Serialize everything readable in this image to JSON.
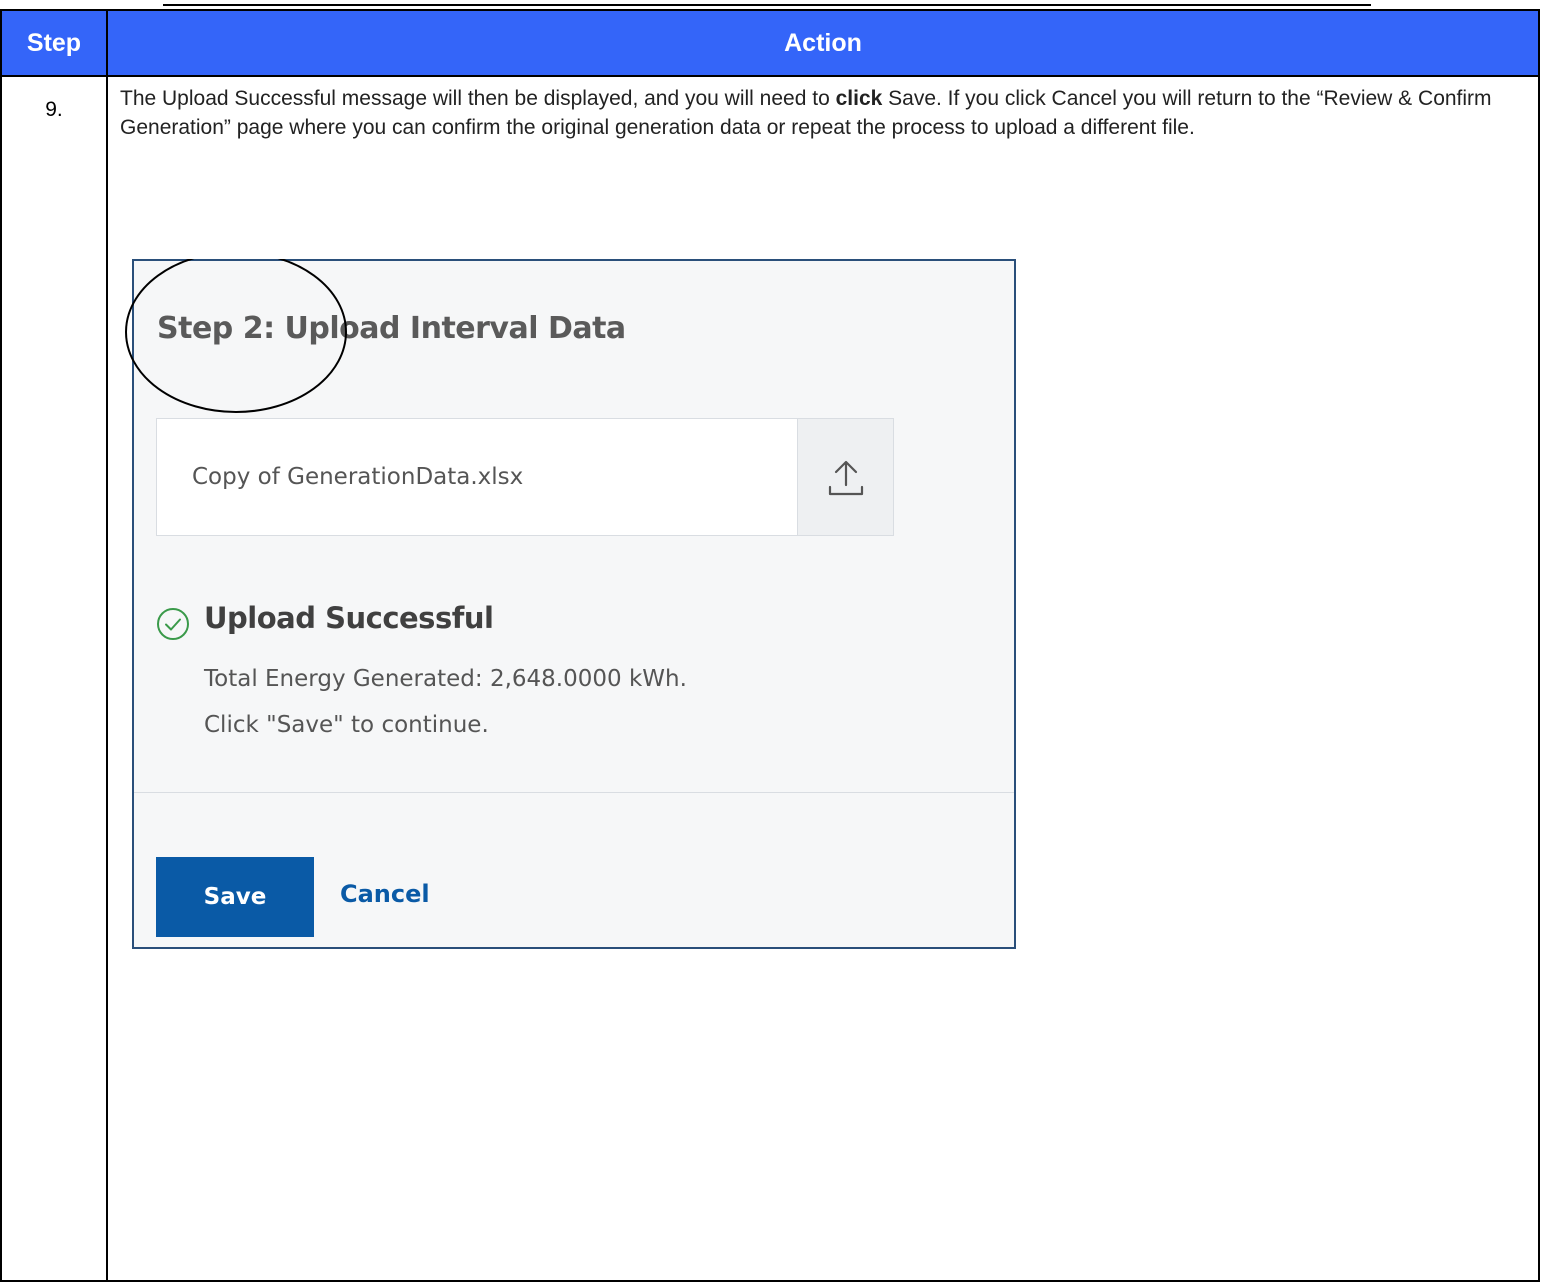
{
  "table": {
    "header_step": "Step",
    "header_action": "Action"
  },
  "row": {
    "step_number": "9.",
    "instruction_part1": "The Upload Successful message will then be displayed, and you will need to ",
    "instruction_bold": "click",
    "instruction_part2": " Save. If you click Cancel you will return to the “Review & Confirm Generation” page where you can confirm the original generation data or repeat the process to upload a different file."
  },
  "screenshot": {
    "title": "Step 2: Upload Interval Data",
    "file_name": "Copy of GenerationData.xlsx",
    "upload_icon": "upload-icon",
    "success_icon": "check-circle-icon",
    "success_title": "Upload Successful",
    "total_energy": "Total Energy Generated: 2,648.0000 kWh.",
    "continue_hint": "Click \"Save\" to continue.",
    "save_label": "Save",
    "cancel_label": "Cancel"
  },
  "colors": {
    "header_bg": "#3465f9",
    "primary_button": "#0a5aa6",
    "success_green": "#3a9a4a"
  }
}
